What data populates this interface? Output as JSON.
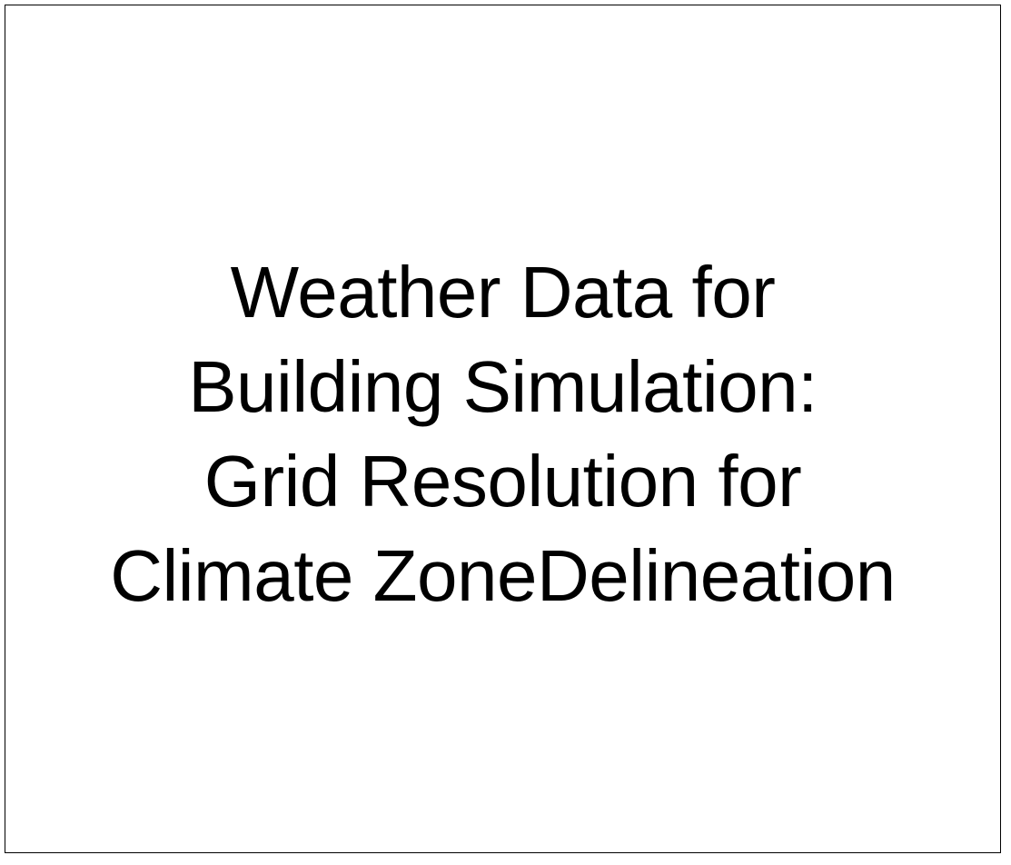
{
  "cover": {
    "title_lines": [
      "Weather Data for",
      "Building Simulation:",
      "Grid Resolution for",
      "Climate ZoneDelineation"
    ]
  }
}
